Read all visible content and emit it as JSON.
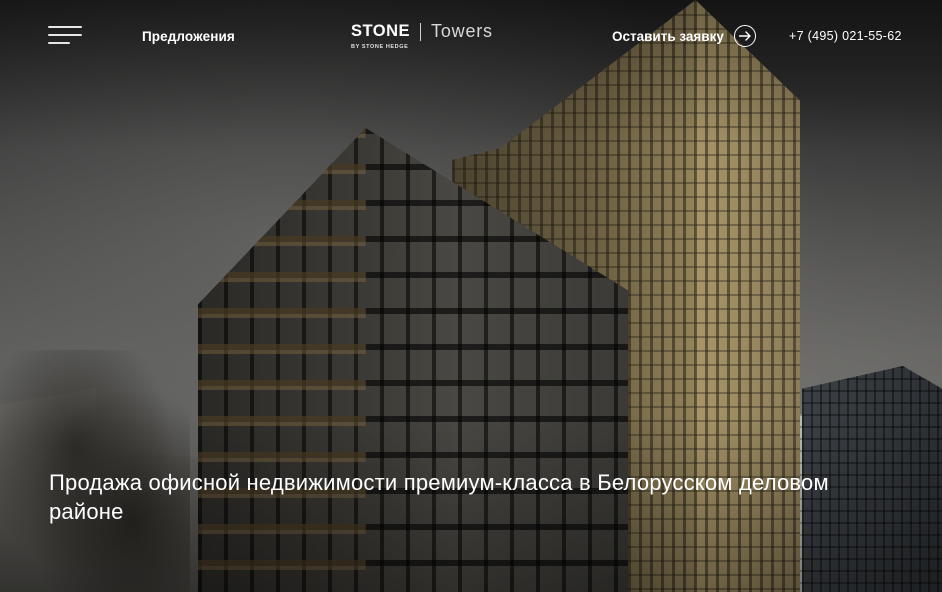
{
  "header": {
    "nav_link": "Предложения",
    "logo": {
      "main": "STONE",
      "sub": "Towers",
      "tag": "BY STONE HEDGE"
    },
    "cta_label": "Оставить заявку",
    "cta_icon": "arrow-right-circle-icon",
    "menu_icon": "hamburger-menu-icon",
    "phone": "+7 (495) 021-55-62"
  },
  "hero": {
    "title": "Продажа офисной недвижимости премиум-класса в Белорусском деловом районе"
  },
  "colors": {
    "text": "#ffffff",
    "background": "#4a4a4a"
  }
}
